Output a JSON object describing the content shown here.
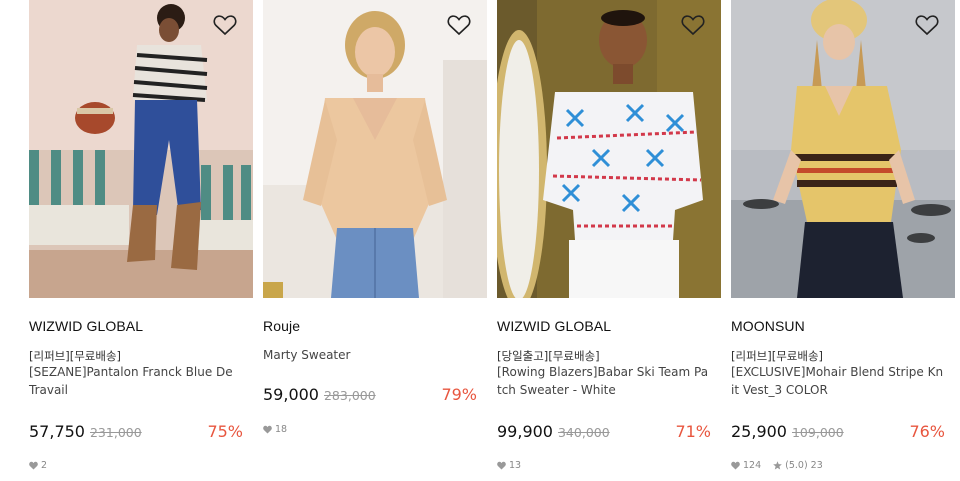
{
  "products": [
    {
      "brand": "WIZWID GLOBAL",
      "tags": "[리퍼브][무료배송]",
      "name": "[SEZANE]Pantalon Franck Blue De Travail",
      "price": "57,750",
      "original_price": "231,000",
      "discount": "75%",
      "likes": "2",
      "heart_icon": "heart-outline-icon"
    },
    {
      "brand": "Rouje",
      "tags": "",
      "name": "Marty Sweater",
      "price": "59,000",
      "original_price": "283,000",
      "discount": "79%",
      "likes": "18",
      "heart_icon": "heart-outline-icon"
    },
    {
      "brand": "WIZWID GLOBAL",
      "tags": "[당일출고][무료배송]",
      "name": "[Rowing Blazers]Babar Ski Team Patch Sweater - White",
      "price": "99,900",
      "original_price": "340,000",
      "discount": "71%",
      "likes": "13",
      "heart_icon": "heart-outline-icon"
    },
    {
      "brand": "MOONSUN",
      "tags": "[리퍼브][무료배송]",
      "name": "[EXCLUSIVE]Mohair Blend Stripe Knit Vest_3 COLOR",
      "price": "25,900",
      "original_price": "109,000",
      "discount": "76%",
      "likes": "124",
      "rating": "(5.0)",
      "reviews": "23",
      "heart_icon": "heart-outline-icon"
    }
  ],
  "colors": {
    "discount": "#e8563f",
    "original_price": "#999999",
    "meta": "#888888"
  }
}
